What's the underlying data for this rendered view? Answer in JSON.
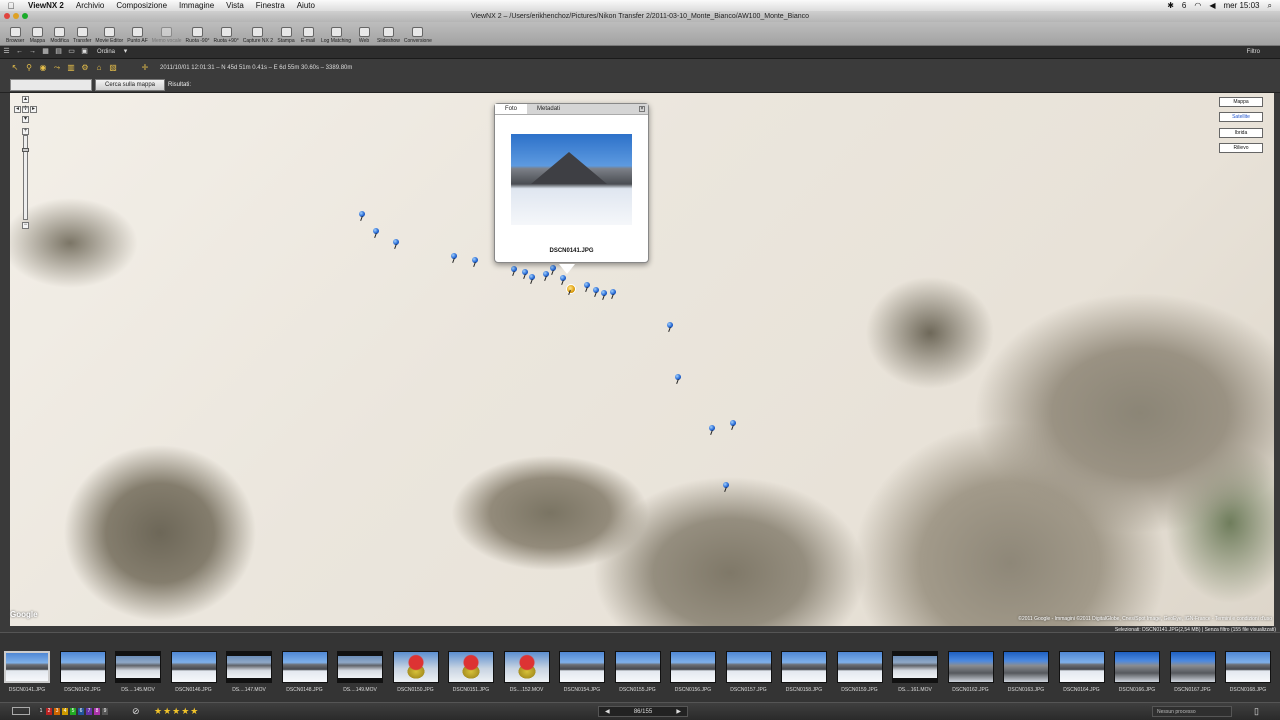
{
  "menubar": {
    "app": "ViewNX 2",
    "items": [
      "Archivio",
      "Composizione",
      "Immagine",
      "Vista",
      "Finestra",
      "Aiuto"
    ],
    "battery": "6",
    "clock": "mer 15:03"
  },
  "window": {
    "title": "ViewNX 2 – /Users/erikhenchoz/Pictures/Nikon Transfer 2/2011-03-10_Monte_Bianco/AW100_Monte_Bianco"
  },
  "toolbar": {
    "items": [
      "Browser",
      "Mappa",
      "Modifica",
      "Transfer",
      "Movie Editor",
      "Punto AF",
      "Memo vocale",
      "Ruota -90°",
      "Ruota +90°",
      "Capture NX 2",
      "Stampa",
      "E-mail",
      "Log Matching",
      "Web",
      "Slideshow",
      "Conversione"
    ]
  },
  "toolbar2": {
    "ordina": "Ordina",
    "filtro": "Filtro"
  },
  "maptools": {
    "coords": "2011/10/01 12:01:31 – N 45d 51m 0.41s – E 6d 55m 30.60s – 3389.80m"
  },
  "search": {
    "button": "Cerca sulla mappa",
    "results_label": "Risultati:"
  },
  "map": {
    "types": [
      "Mappa",
      "Satellite",
      "Ibrida",
      "Rilievo"
    ],
    "selected_type": "Satellite",
    "google": "Google",
    "copyright": "©2011 Google - Immagini ©2011 DigitalGlobe, Cnes/Spot Image, GeoEye, IGN-France - Termini e condizioni d'uso"
  },
  "popup": {
    "tabs": [
      "Foto",
      "Metadati"
    ],
    "filename": "DSCN0141.JPG"
  },
  "selection_info": "Selezionati: DSCN0141.JPG(2,54 MB) | Senza filtro (155 file visualizzati)",
  "filmstrip": [
    {
      "label": "DSCN0141.JPG",
      "kind": "photo"
    },
    {
      "label": "DSCN0142.JPG",
      "kind": "photo"
    },
    {
      "label": "DS....145.MOV",
      "kind": "mov"
    },
    {
      "label": "DSCN0146.JPG",
      "kind": "photo"
    },
    {
      "label": "DS....147.MOV",
      "kind": "mov"
    },
    {
      "label": "DSCN0148.JPG",
      "kind": "photo"
    },
    {
      "label": "DS....149.MOV",
      "kind": "mov"
    },
    {
      "label": "DSCN0150.JPG",
      "kind": "red"
    },
    {
      "label": "DSCN0151.JPG",
      "kind": "red"
    },
    {
      "label": "DS....152.MOV",
      "kind": "red"
    },
    {
      "label": "DSCN0154.JPG",
      "kind": "photo"
    },
    {
      "label": "DSCN0155.JPG",
      "kind": "photo"
    },
    {
      "label": "DSCN0156.JPG",
      "kind": "photo"
    },
    {
      "label": "DSCN0157.JPG",
      "kind": "photo"
    },
    {
      "label": "DSCN0158.JPG",
      "kind": "photo"
    },
    {
      "label": "DSCN0159.JPG",
      "kind": "photo"
    },
    {
      "label": "DS....161.MOV",
      "kind": "mov"
    },
    {
      "label": "DSCN0162.JPG",
      "kind": "blue"
    },
    {
      "label": "DSCN0163.JPG",
      "kind": "blue"
    },
    {
      "label": "DSCN0164.JPG",
      "kind": "photo"
    },
    {
      "label": "DSCN0166.JPG",
      "kind": "blue"
    },
    {
      "label": "DSCN0167.JPG",
      "kind": "blue"
    },
    {
      "label": "DSCN0168.JPG",
      "kind": "photo"
    }
  ],
  "statusbar": {
    "rating_labels": [
      "1",
      "2",
      "3",
      "4",
      "5",
      "6",
      "7",
      "8",
      "9"
    ],
    "stars": "★★★★★",
    "page": "86/155",
    "process": "Nessun processo"
  }
}
